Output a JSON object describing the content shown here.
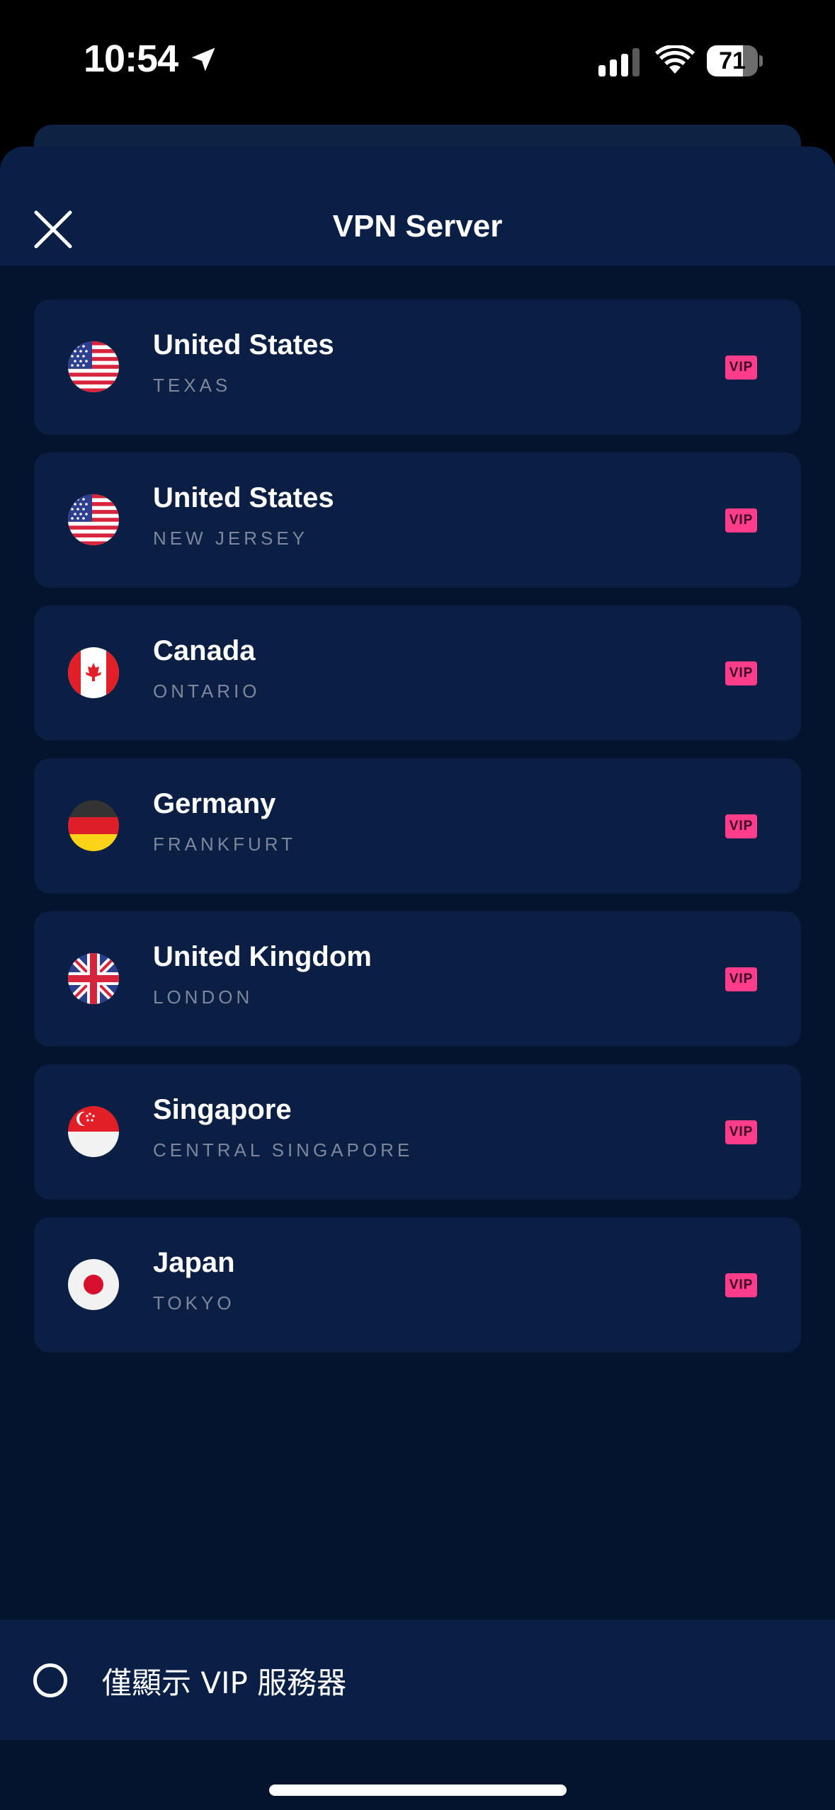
{
  "status_bar": {
    "time": "10:54",
    "battery": "71",
    "battery_level": 0.71,
    "icons": [
      "location-arrow-icon",
      "cellular-signal-icon",
      "wifi-icon",
      "battery-icon"
    ]
  },
  "header": {
    "title": "VPN Server",
    "close_icon": "close-icon"
  },
  "servers": [
    {
      "country": "United States",
      "region": "TEXAS",
      "flag": "us",
      "badge": "VIP"
    },
    {
      "country": "United States",
      "region": "NEW JERSEY",
      "flag": "us",
      "badge": "VIP"
    },
    {
      "country": "Canada",
      "region": "ONTARIO",
      "flag": "ca",
      "badge": "VIP"
    },
    {
      "country": "Germany",
      "region": "FRANKFURT",
      "flag": "de",
      "badge": "VIP"
    },
    {
      "country": "United Kingdom",
      "region": "LONDON",
      "flag": "gb",
      "badge": "VIP"
    },
    {
      "country": "Singapore",
      "region": "CENTRAL SINGAPORE",
      "flag": "sg",
      "badge": "VIP"
    },
    {
      "country": "Japan",
      "region": "TOKYO",
      "flag": "jp",
      "badge": "VIP"
    }
  ],
  "footer": {
    "filter_label": "僅顯示 VIP 服務器",
    "filter_checked": false
  },
  "colors": {
    "background": "#04132e",
    "card": "#0b1f44",
    "header": "#0a1f45",
    "vip_badge": "#ff3d8b",
    "region_text": "#7c879c"
  }
}
